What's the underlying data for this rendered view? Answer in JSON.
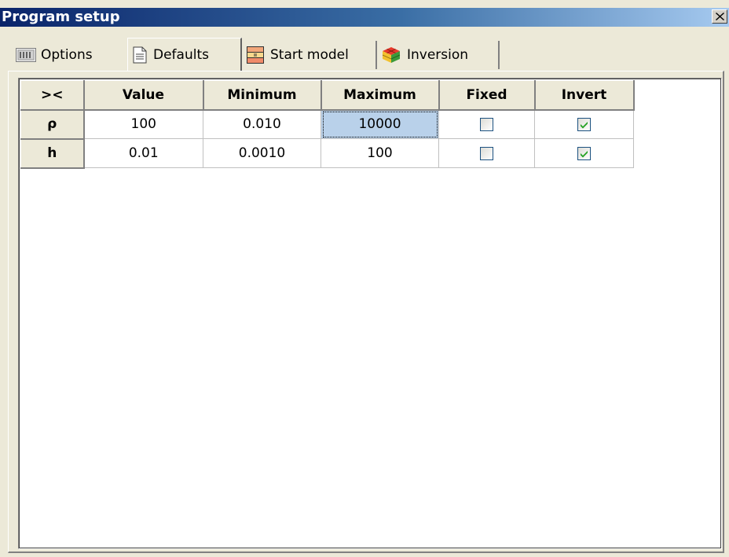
{
  "window": {
    "title": "Program setup",
    "close_glyph": "✕"
  },
  "tabs": [
    {
      "label": "Options",
      "icon": "options-icon",
      "active": false
    },
    {
      "label": "Defaults",
      "icon": "document-icon",
      "active": true
    },
    {
      "label": "Start model",
      "icon": "start-model-icon",
      "active": false
    },
    {
      "label": "Inversion",
      "icon": "cube-icon",
      "active": false
    }
  ],
  "grid": {
    "corner_label": "><",
    "columns": [
      "Value",
      "Minimum",
      "Maximum",
      "Fixed",
      "Invert"
    ],
    "rows": [
      {
        "header": "ρ",
        "value": "100",
        "minimum": "0.010",
        "maximum": "10000",
        "fixed": false,
        "invert": true
      },
      {
        "header": "h",
        "value": "0.01",
        "minimum": "0.0010",
        "maximum": "100",
        "fixed": false,
        "invert": true
      }
    ],
    "selected_cell": "rows.0.maximum"
  },
  "colors": {
    "title_gradient_start": "#0a246a",
    "title_gradient_end": "#a6caf0",
    "selected_cell": "#b9d1ea",
    "check_mark": "#21a121"
  }
}
